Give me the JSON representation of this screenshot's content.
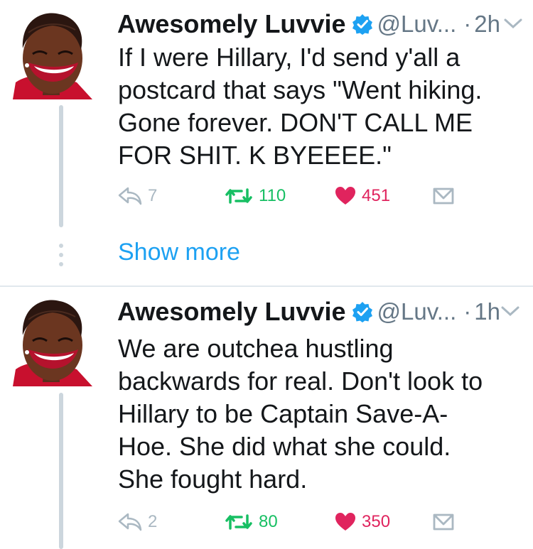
{
  "tweets": [
    {
      "name": "Awesomely Luvvie",
      "handle": "@Luv...",
      "time": "2h",
      "text_lines": [
        "If I were Hillary, I'd send y'all a",
        "postcard that says \"Went hiking.",
        "Gone forever. DON'T CALL ME",
        "FOR SHIT. K BYEEEE.\""
      ],
      "replies": "7",
      "retweets": "110",
      "likes": "451"
    },
    {
      "name": "Awesomely Luvvie",
      "handle": "@Luv...",
      "time": "1h",
      "text_lines": [
        "We are outchea hustling",
        "backwards for real. Don't look to",
        "Hillary to be Captain Save-A-",
        "Hoe. She did what she could.",
        "She fought hard."
      ],
      "replies": "2",
      "retweets": "80",
      "likes": "350"
    }
  ],
  "show_more": "Show more",
  "icons": {
    "reply": "reply-icon",
    "retweet": "retweet-icon",
    "like": "heart-icon",
    "dm": "direct-message-icon",
    "verified": "verified-badge-icon",
    "caret": "chevron-down-icon"
  },
  "colors": {
    "retweet": "#17bf63",
    "like": "#e0245e",
    "link": "#1da1f2",
    "verified": "#1da1f2",
    "muted": "#657786"
  }
}
